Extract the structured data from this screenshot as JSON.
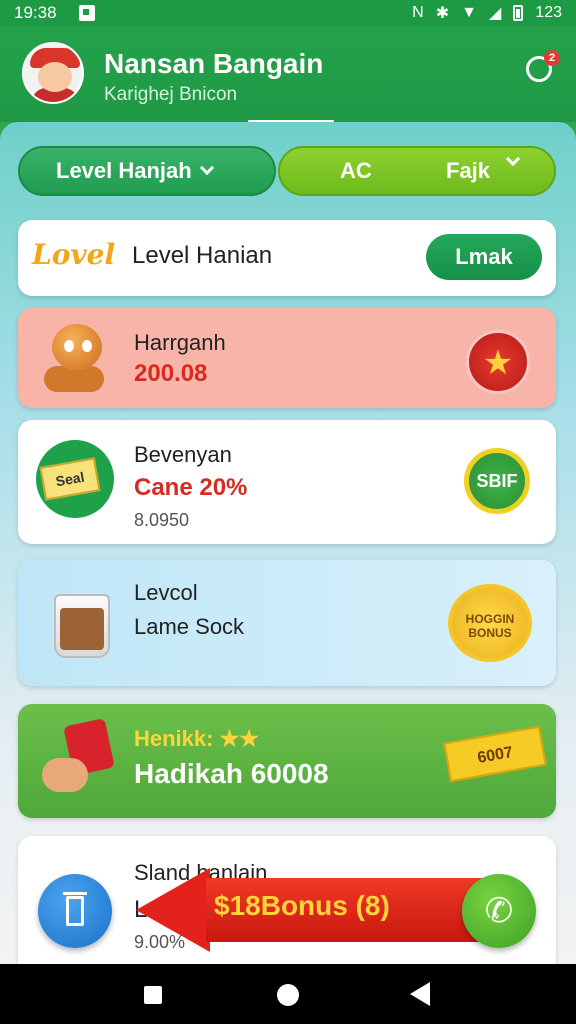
{
  "status_bar": {
    "time": "19:38",
    "battery_text": "123"
  },
  "header": {
    "title": "Nansan Bangain",
    "subtitle": "Karighej Bnicon",
    "chat_badge": "2"
  },
  "filters": {
    "left_label": "Level Hanjah",
    "right_ac": "AC",
    "right_label": "Fajk"
  },
  "cards": [
    {
      "logo": "Lovel",
      "title": "Level Hanian",
      "button": "Lmak"
    },
    {
      "title": "Harrganh",
      "value": "200.08",
      "badge": "★"
    },
    {
      "title": "Bevenyan",
      "value": "Cane 20%",
      "sub": "8.0950",
      "voucher": "Seal",
      "badge": "SBIF"
    },
    {
      "title": "Levcol",
      "sub": "Lame Sock",
      "badge": "HOGGIN BONUS"
    },
    {
      "title": "Henikk: ★★",
      "value": "Hadikah 60008",
      "badge": "6007"
    },
    {
      "title": "Sland banlain",
      "line2": "L",
      "sub": "9.00%"
    }
  ],
  "bonus": {
    "label": "$18Bonus (8)"
  },
  "icons": {
    "chat": "chat-bubble-icon",
    "delete": "trash-icon",
    "call": "phone-icon"
  },
  "colors": {
    "primary_green": "#1f9a44",
    "accent_red": "#e3231b",
    "accent_yellow": "#ffd33a"
  }
}
